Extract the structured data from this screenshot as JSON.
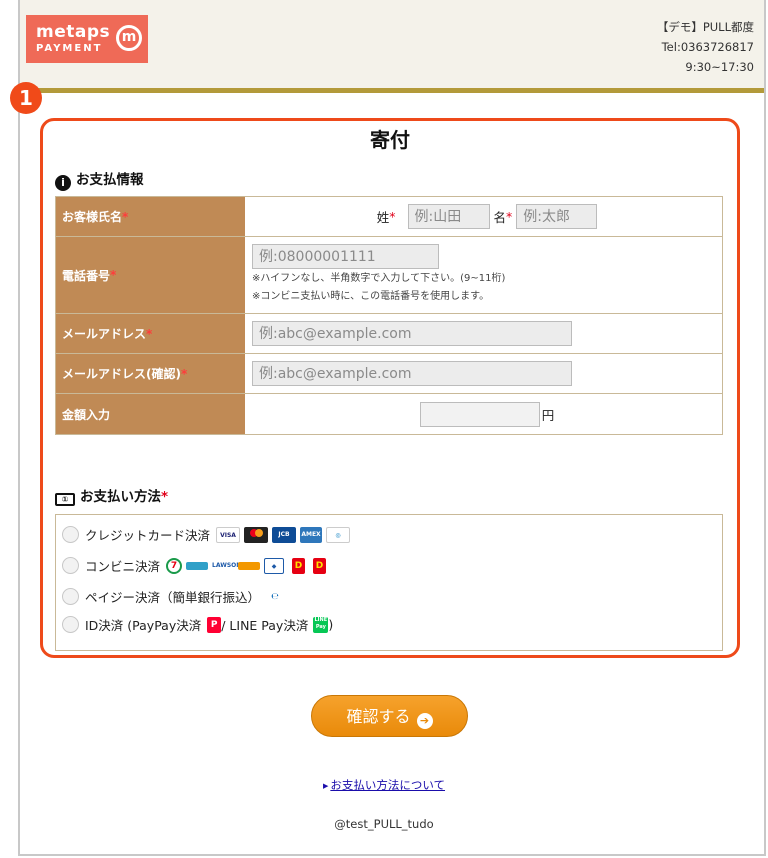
{
  "header": {
    "logo_line1": "metaps",
    "logo_line2": "PAYMENT",
    "logo_mark": "m",
    "shop_name": "【デモ】PULL都度",
    "tel": "Tel:0363726817",
    "hours": "9:30~17:30"
  },
  "marker": "1",
  "title": "寄付",
  "payment_info": {
    "heading": "お支払情報",
    "name": {
      "label": "お客様氏名",
      "required": "*",
      "last_label": "姓",
      "last_placeholder": "例:山田",
      "first_label": "名",
      "first_placeholder": "例:太郎"
    },
    "phone": {
      "label": "電話番号",
      "required": "*",
      "placeholder": "例:08000001111",
      "note1": "※ハイフンなし、半角数字で入力して下さい。(9~11桁)",
      "note2": "※コンビニ支払い時に、この電話番号を使用します。"
    },
    "email": {
      "label": "メールアドレス",
      "required": "*",
      "placeholder": "例:abc@example.com"
    },
    "email_confirm": {
      "label": "メールアドレス(確認)",
      "required": "*",
      "placeholder": "例:abc@example.com"
    },
    "amount": {
      "label": "金額入力",
      "value": "",
      "unit": "円"
    }
  },
  "payment_method": {
    "heading": "お支払い方法",
    "required": "*",
    "options": [
      {
        "label": "クレジットカード決済"
      },
      {
        "label": "コンビニ決済"
      },
      {
        "label": "ペイジー決済（簡単銀行振込）"
      },
      {
        "label": "ID決済 (PayPay決済",
        "middle": " / LINE Pay決済",
        "suffix": " )"
      }
    ]
  },
  "confirm_button": "確認する",
  "about_link": "お支払い方法について",
  "footer": "@test_PULL_tudo"
}
